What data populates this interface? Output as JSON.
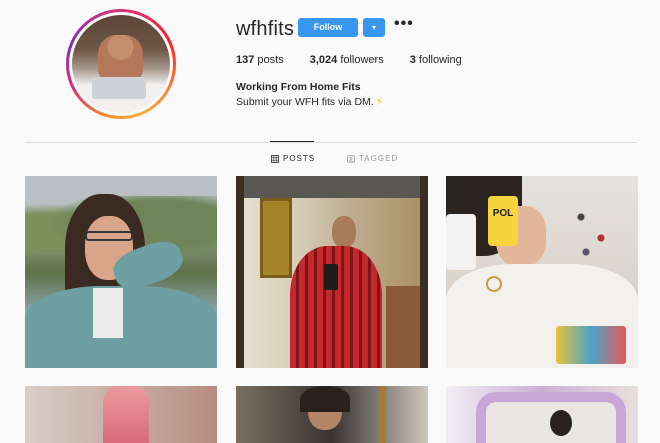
{
  "profile": {
    "username": "wfhfits",
    "follow_label": "Follow",
    "dropdown_glyph": "▾",
    "more_glyph": "•••",
    "stats": [
      {
        "count": "137",
        "label": "posts"
      },
      {
        "count": "3,024",
        "label": "followers"
      },
      {
        "count": "3",
        "label": "following"
      }
    ],
    "bio_name": "Working From Home Fits",
    "bio_text": "Submit your WFH fits via DM.",
    "bio_emoji": "⚡"
  },
  "tabs": [
    {
      "label": "POSTS",
      "icon": "grid-icon",
      "active": true
    },
    {
      "label": "TAGGED",
      "icon": "tagged-icon",
      "active": false
    }
  ],
  "colors": {
    "accent": "#3897f0",
    "text": "#262626",
    "muted": "#999999",
    "background": "#fafafa",
    "divider": "#dbdbdb"
  },
  "posts": [
    {
      "mug_text": "POL"
    }
  ]
}
